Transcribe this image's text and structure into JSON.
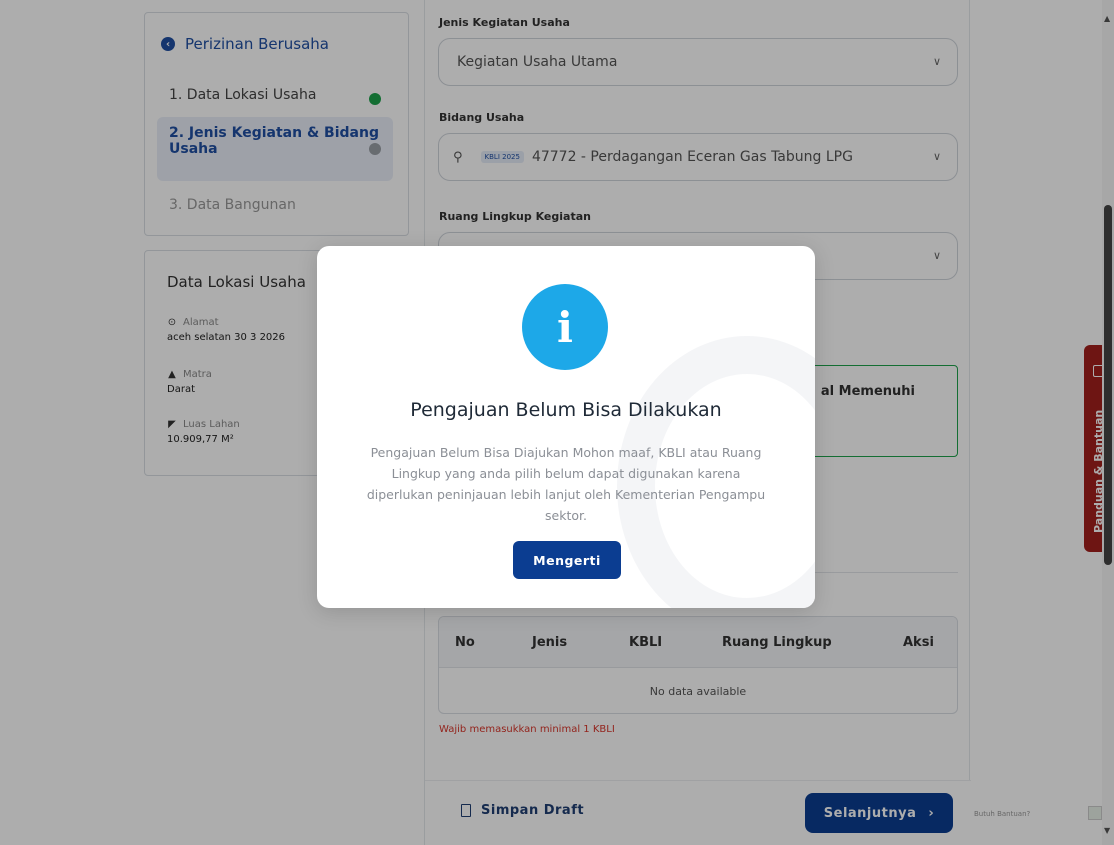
{
  "stepper": {
    "title": "Perizinan Berusaha",
    "steps": [
      {
        "label": "1. Data Lokasi Usaha",
        "status": "done"
      },
      {
        "label": "2. Jenis Kegiatan & Bidang Usaha",
        "status": "active"
      },
      {
        "label": "3. Data Bangunan",
        "status": "pending"
      }
    ]
  },
  "lokasi": {
    "title": "Data Lokasi Usaha",
    "items": [
      {
        "label": "Alamat",
        "value": "aceh selatan 30 3 2026",
        "icon": "location-pin-icon"
      },
      {
        "label": "Matra",
        "value": "Darat",
        "icon": "mountain-icon"
      },
      {
        "label": "Luas Lahan",
        "value": "10.909,77 M²",
        "icon": "area-icon"
      }
    ]
  },
  "form": {
    "jenis_kegiatan": {
      "label": "Jenis Kegiatan Usaha",
      "value": "Kegiatan Usaha Utama"
    },
    "bidang_usaha": {
      "label": "Bidang Usaha",
      "badge": "KBLI 2025",
      "value": "47772 - Perdagangan Eceran Gas Tabung LPG"
    },
    "ruang_lingkup": {
      "label": "Ruang Lingkup Kegiatan",
      "value": ""
    },
    "green_box_text": "al Memenuhi",
    "table": {
      "columns": [
        "No",
        "Jenis",
        "KBLI",
        "Ruang Lingkup",
        "Aksi"
      ],
      "empty": "No data available"
    },
    "error": "Wajib memasukkan minimal 1 KBLI"
  },
  "footer": {
    "draft_label": "Simpan Draft",
    "next_label": "Selanjutnya",
    "next_icon": "›",
    "help_small": "Butuh Bantuan?"
  },
  "help_tab": {
    "label": "Panduan & Bantuan"
  },
  "modal": {
    "icon": "i",
    "title": "Pengajuan Belum Bisa Dilakukan",
    "message": "Pengajuan Belum Bisa Diajukan Mohon maaf, KBLI atau Ruang Lingkup yang anda pilih belum dapat digunakan karena diperlukan peninjauan lebih lanjut oleh Kementerian Pengampu sektor.",
    "button": "Mengerti"
  },
  "colors": {
    "primary": "#0b3d91",
    "accent_blue": "#1da8e8",
    "success": "#1ea24c",
    "error": "#d9362b",
    "help_tab": "#a3201d"
  }
}
